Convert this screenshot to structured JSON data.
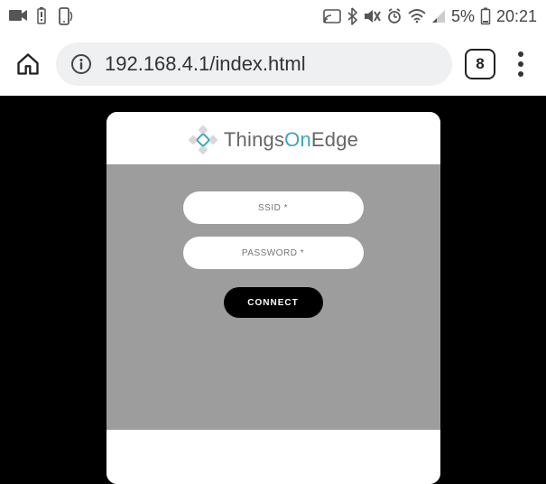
{
  "status": {
    "battery_percent": "5%",
    "clock": "20:21"
  },
  "browser": {
    "url": "192.168.4.1/index.html",
    "tab_count": "8"
  },
  "page": {
    "logo": {
      "part1": "Things",
      "part2": "On",
      "part3": "Edge"
    },
    "form": {
      "ssid_placeholder": "SSID *",
      "password_placeholder": "PASSWORD *",
      "connect_label": "CONNECT"
    }
  }
}
